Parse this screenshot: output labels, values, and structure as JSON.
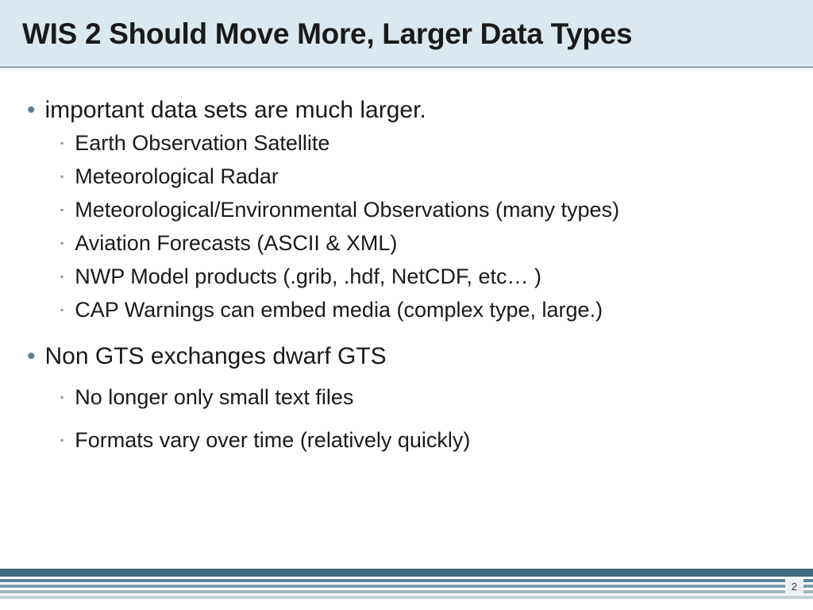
{
  "title": "WIS 2 Should Move More, Larger Data Types",
  "group1": {
    "heading": "important data sets are much larger.",
    "items": [
      "Earth Observation Satellite",
      "Meteorological Radar",
      "Meteorological/Environmental Observations (many types)",
      "Aviation Forecasts (ASCII & XML)",
      "NWP Model products (.grib, .hdf, NetCDF, etc… )",
      "CAP Warnings can embed media (complex type, large.)"
    ]
  },
  "group2": {
    "heading": "Non GTS exchanges dwarf GTS",
    "items": [
      "No longer only small text files",
      "Formats vary over time (relatively quickly)"
    ]
  },
  "pageNumber": "2"
}
